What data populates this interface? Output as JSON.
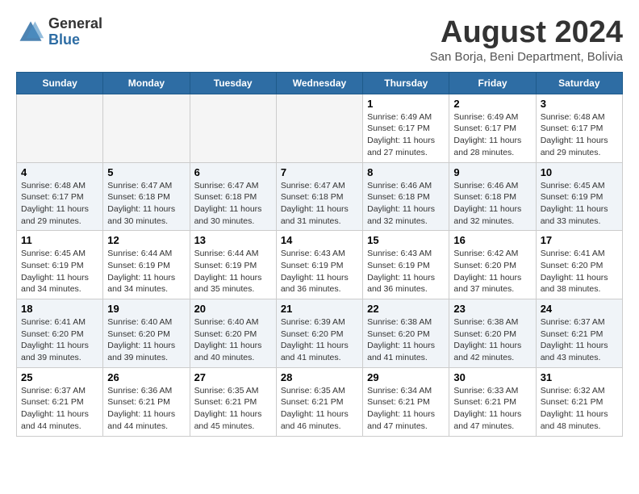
{
  "header": {
    "logo_general": "General",
    "logo_blue": "Blue",
    "main_title": "August 2024",
    "subtitle": "San Borja, Beni Department, Bolivia"
  },
  "days_of_week": [
    "Sunday",
    "Monday",
    "Tuesday",
    "Wednesday",
    "Thursday",
    "Friday",
    "Saturday"
  ],
  "weeks": [
    {
      "alt": false,
      "cells": [
        {
          "num": "",
          "text": ""
        },
        {
          "num": "",
          "text": ""
        },
        {
          "num": "",
          "text": ""
        },
        {
          "num": "",
          "text": ""
        },
        {
          "num": "1",
          "text": "Sunrise: 6:49 AM\nSunset: 6:17 PM\nDaylight: 11 hours and 27 minutes."
        },
        {
          "num": "2",
          "text": "Sunrise: 6:49 AM\nSunset: 6:17 PM\nDaylight: 11 hours and 28 minutes."
        },
        {
          "num": "3",
          "text": "Sunrise: 6:48 AM\nSunset: 6:17 PM\nDaylight: 11 hours and 29 minutes."
        }
      ]
    },
    {
      "alt": true,
      "cells": [
        {
          "num": "4",
          "text": "Sunrise: 6:48 AM\nSunset: 6:17 PM\nDaylight: 11 hours and 29 minutes."
        },
        {
          "num": "5",
          "text": "Sunrise: 6:47 AM\nSunset: 6:18 PM\nDaylight: 11 hours and 30 minutes."
        },
        {
          "num": "6",
          "text": "Sunrise: 6:47 AM\nSunset: 6:18 PM\nDaylight: 11 hours and 30 minutes."
        },
        {
          "num": "7",
          "text": "Sunrise: 6:47 AM\nSunset: 6:18 PM\nDaylight: 11 hours and 31 minutes."
        },
        {
          "num": "8",
          "text": "Sunrise: 6:46 AM\nSunset: 6:18 PM\nDaylight: 11 hours and 32 minutes."
        },
        {
          "num": "9",
          "text": "Sunrise: 6:46 AM\nSunset: 6:18 PM\nDaylight: 11 hours and 32 minutes."
        },
        {
          "num": "10",
          "text": "Sunrise: 6:45 AM\nSunset: 6:19 PM\nDaylight: 11 hours and 33 minutes."
        }
      ]
    },
    {
      "alt": false,
      "cells": [
        {
          "num": "11",
          "text": "Sunrise: 6:45 AM\nSunset: 6:19 PM\nDaylight: 11 hours and 34 minutes."
        },
        {
          "num": "12",
          "text": "Sunrise: 6:44 AM\nSunset: 6:19 PM\nDaylight: 11 hours and 34 minutes."
        },
        {
          "num": "13",
          "text": "Sunrise: 6:44 AM\nSunset: 6:19 PM\nDaylight: 11 hours and 35 minutes."
        },
        {
          "num": "14",
          "text": "Sunrise: 6:43 AM\nSunset: 6:19 PM\nDaylight: 11 hours and 36 minutes."
        },
        {
          "num": "15",
          "text": "Sunrise: 6:43 AM\nSunset: 6:19 PM\nDaylight: 11 hours and 36 minutes."
        },
        {
          "num": "16",
          "text": "Sunrise: 6:42 AM\nSunset: 6:20 PM\nDaylight: 11 hours and 37 minutes."
        },
        {
          "num": "17",
          "text": "Sunrise: 6:41 AM\nSunset: 6:20 PM\nDaylight: 11 hours and 38 minutes."
        }
      ]
    },
    {
      "alt": true,
      "cells": [
        {
          "num": "18",
          "text": "Sunrise: 6:41 AM\nSunset: 6:20 PM\nDaylight: 11 hours and 39 minutes."
        },
        {
          "num": "19",
          "text": "Sunrise: 6:40 AM\nSunset: 6:20 PM\nDaylight: 11 hours and 39 minutes."
        },
        {
          "num": "20",
          "text": "Sunrise: 6:40 AM\nSunset: 6:20 PM\nDaylight: 11 hours and 40 minutes."
        },
        {
          "num": "21",
          "text": "Sunrise: 6:39 AM\nSunset: 6:20 PM\nDaylight: 11 hours and 41 minutes."
        },
        {
          "num": "22",
          "text": "Sunrise: 6:38 AM\nSunset: 6:20 PM\nDaylight: 11 hours and 41 minutes."
        },
        {
          "num": "23",
          "text": "Sunrise: 6:38 AM\nSunset: 6:20 PM\nDaylight: 11 hours and 42 minutes."
        },
        {
          "num": "24",
          "text": "Sunrise: 6:37 AM\nSunset: 6:21 PM\nDaylight: 11 hours and 43 minutes."
        }
      ]
    },
    {
      "alt": false,
      "cells": [
        {
          "num": "25",
          "text": "Sunrise: 6:37 AM\nSunset: 6:21 PM\nDaylight: 11 hours and 44 minutes."
        },
        {
          "num": "26",
          "text": "Sunrise: 6:36 AM\nSunset: 6:21 PM\nDaylight: 11 hours and 44 minutes."
        },
        {
          "num": "27",
          "text": "Sunrise: 6:35 AM\nSunset: 6:21 PM\nDaylight: 11 hours and 45 minutes."
        },
        {
          "num": "28",
          "text": "Sunrise: 6:35 AM\nSunset: 6:21 PM\nDaylight: 11 hours and 46 minutes."
        },
        {
          "num": "29",
          "text": "Sunrise: 6:34 AM\nSunset: 6:21 PM\nDaylight: 11 hours and 47 minutes."
        },
        {
          "num": "30",
          "text": "Sunrise: 6:33 AM\nSunset: 6:21 PM\nDaylight: 11 hours and 47 minutes."
        },
        {
          "num": "31",
          "text": "Sunrise: 6:32 AM\nSunset: 6:21 PM\nDaylight: 11 hours and 48 minutes."
        }
      ]
    }
  ]
}
